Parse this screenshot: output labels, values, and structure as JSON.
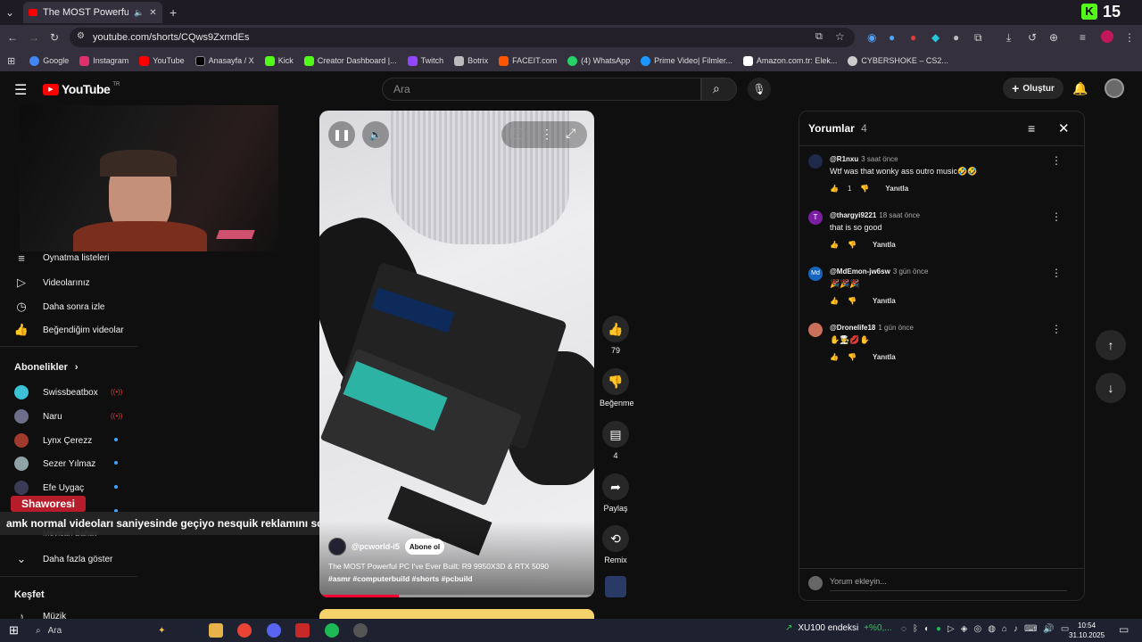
{
  "browser": {
    "tab_title": "The MOST Powerful PC I've",
    "url": "youtube.com/shorts/CQws9ZxmdEs",
    "bookmarks": [
      "Google",
      "Instagram",
      "YouTube",
      "Anasayfa / X",
      "Kick",
      "Creator Dashboard |...",
      "Twitch",
      "Botrix",
      "FACEIT.com",
      "(4) WhatsApp",
      "Prime Video| Filmler...",
      "Amazon.com.tr: Elek...",
      "CYBERSHOKE – CS2..."
    ],
    "bookmark_colors": [
      "#4285f4",
      "#e1306c",
      "#ff0000",
      "#000000",
      "#53fc18",
      "#53fc18",
      "#9146ff",
      "#bbbbbb",
      "#ff5500",
      "#25d366",
      "#1a98ff",
      "#ffffff",
      "#cccccc"
    ],
    "corner_badge": "15"
  },
  "header": {
    "logo": "YouTube",
    "logo_sup": "TR",
    "search_placeholder": "Ara",
    "create_label": "Oluştur"
  },
  "sidebar": {
    "items": [
      {
        "label": "Oynatma listeleri",
        "icon": "playlist-icon"
      },
      {
        "label": "Videolarınız",
        "icon": "video-icon"
      },
      {
        "label": "Daha sonra izle",
        "icon": "clock-icon"
      },
      {
        "label": "Beğendiğim videolar",
        "icon": "thumbs-up-icon"
      }
    ],
    "subs_title": "Abonelikler",
    "subscriptions": [
      {
        "name": "Swissbeatbox",
        "color": "#3cc1d6",
        "live": true
      },
      {
        "name": "Naru",
        "color": "#6b6f8a",
        "live": true
      },
      {
        "name": "Lynx Çerezz",
        "color": "#a03a2c",
        "live": false
      },
      {
        "name": "Sezer Yılmaz",
        "color": "#8fa3a8",
        "live": false
      },
      {
        "name": "Efe Uygaç",
        "color": "#3b3b55",
        "live": false
      }
    ],
    "partial_sub": "Mevlcan Bahav",
    "more_label": "Daha fazla göster",
    "explore_title": "Keşfet",
    "music_label": "Müzik"
  },
  "overlay": {
    "streamer_tag": "Shaworesi",
    "caption": "amk normal videoları saniyesinde geçiyo nesquik reklamını sonuna kadar izledi"
  },
  "video": {
    "channel": "@pcworld-i5",
    "subscribe_label": "Abone ol",
    "title": "The MOST Powerful PC I've Ever Built: R9 9950X3D & RTX 5090",
    "hashtags": "#asmr #computerbuild #shorts #pcbuild",
    "progress_fraction": 0.29
  },
  "actions": {
    "likes": "79",
    "dislike_label": "Beğenme",
    "comments_count": "4",
    "share_label": "Paylaş",
    "remix_label": "Remix"
  },
  "comments_panel": {
    "title": "Yorumlar",
    "count": "4",
    "reply_label": "Yanıtla",
    "add_placeholder": "Yorum ekleyin...",
    "comments": [
      {
        "user": "@R1nxu",
        "time": "3 saat önce",
        "text": "Wtf was that wonky ass outro music🤣🤣",
        "likes": "1",
        "avatar_color": "#1d2a4a"
      },
      {
        "user": "@thargyi9221",
        "time": "18 saat önce",
        "text": "that is so good",
        "likes": "",
        "avatar_color": "#7b1fa2",
        "initial": "T"
      },
      {
        "user": "@MdEmon-jw6sw",
        "time": "3 gün önce",
        "text": "🎉🎉🎉",
        "likes": "",
        "avatar_color": "#1565c0",
        "initial": "Md"
      },
      {
        "user": "@Dronelife18",
        "time": "1 gün önce",
        "text": "✋👨‍🍳💋✋",
        "likes": "",
        "avatar_color": "#c96f5a"
      }
    ]
  },
  "taskbar": {
    "search_placeholder": "Ara",
    "stock_label": "XU100 endeksi",
    "stock_change": "+%0,...",
    "time": "10:54",
    "date": "31.10.2025"
  }
}
